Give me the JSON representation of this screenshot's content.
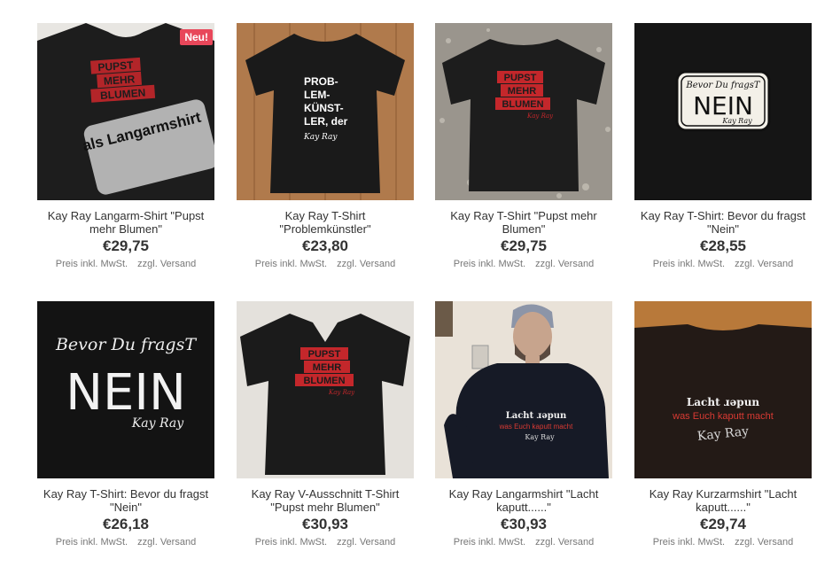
{
  "products": [
    {
      "title": "Kay Ray Langarm-Shirt \"Pupst mehr Blumen\"",
      "price": "€29,75",
      "badge": "Neu!",
      "image": "black-tshirt-pupst-mehr-blumen-langarm",
      "overlay": "als Langarmshirt"
    },
    {
      "title": "Kay Ray T-Shirt \"Problemkünstler\"",
      "price": "€23,80",
      "image": "black-tshirt-problemkuenstler"
    },
    {
      "title": "Kay Ray T-Shirt \"Pupst mehr Blumen\"",
      "price": "€29,75",
      "image": "black-tshirt-pupst-mehr-blumen-gravel"
    },
    {
      "title": "Kay Ray T-Shirt: Bevor du fragst \"Nein\"",
      "price": "€28,55",
      "image": "black-shirt-bevor-du-fragst-nein-sign"
    },
    {
      "title": "Kay Ray T-Shirt: Bevor du fragst \"Nein\"",
      "price": "€26,18",
      "image": "black-shirt-bevor-du-fragst-nein-chalk"
    },
    {
      "title": "Kay Ray V-Ausschnitt T-Shirt \"Pupst mehr Blumen\"",
      "price": "€30,93",
      "image": "black-vneck-pupst-mehr-blumen"
    },
    {
      "title": "Kay Ray Langarmshirt \"Lacht kaputt......\"",
      "price": "€30,93",
      "image": "person-wearing-lacht-longsleeve"
    },
    {
      "title": "Kay Ray Kurzarmshirt \"Lacht kaputt......\"",
      "price": "€29,74",
      "image": "black-tshirt-lacht-wood"
    }
  ],
  "meta": {
    "tax_label": "Preis inkl. MwSt.",
    "shipping_label": "zzgl. Versand"
  },
  "design_text": {
    "pupst": [
      "PUPST",
      "MEHR",
      "BLUMEN"
    ],
    "problem": [
      "PROB-",
      "LEM-",
      "KÜNST-",
      "LER, der"
    ],
    "signature": "Kay Ray",
    "bevor": "Bevor Du fragsT",
    "nein": "NEIN",
    "lacht1": "Lacht ɹǝpun",
    "lacht2": "was Euch kaputt macht"
  },
  "colors": {
    "badge": "#e8475a",
    "price": "#333333",
    "meta": "#777777",
    "shirt": "#1c1c1c",
    "print_red": "#c4272b"
  }
}
